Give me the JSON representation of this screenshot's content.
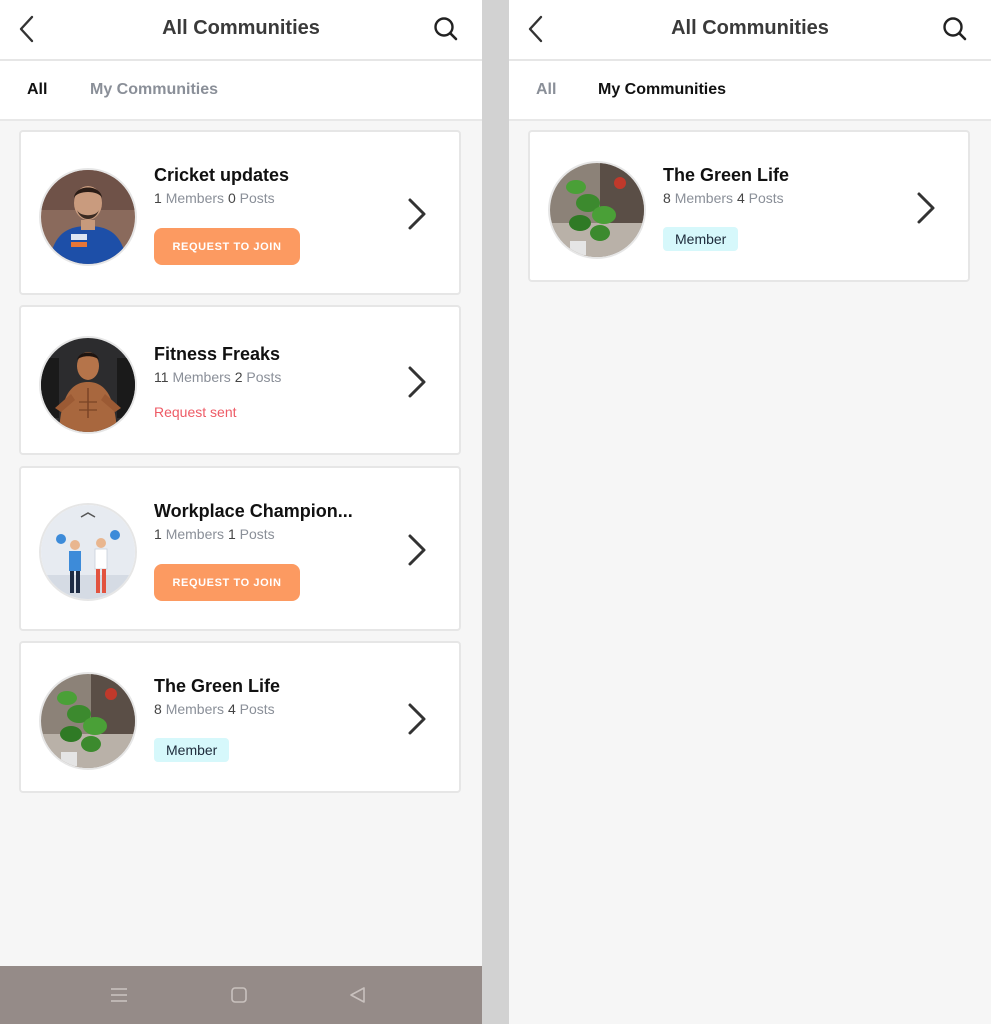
{
  "left": {
    "header": {
      "title": "All Communities",
      "back_icon": "chevron-left-icon",
      "search_icon": "search-icon"
    },
    "tabs": [
      {
        "label": "All",
        "active": true
      },
      {
        "label": "My Communities",
        "active": false
      }
    ],
    "communities": [
      {
        "name": "Cricket updates",
        "members": "1",
        "members_label": "Members",
        "posts": "0",
        "posts_label": "Posts",
        "action": "REQUEST TO JOIN",
        "avatar": "cricketer-photo"
      },
      {
        "name": "Fitness Freaks",
        "members": "11",
        "members_label": "Members",
        "posts": "2",
        "posts_label": "Posts",
        "status": "Request sent",
        "avatar": "bodybuilder-photo"
      },
      {
        "name": "Workplace Champion...",
        "members": "1",
        "members_label": "Members",
        "posts": "1",
        "posts_label": "Posts",
        "action": "REQUEST TO JOIN",
        "avatar": "workplace-illustration"
      },
      {
        "name": "The Green Life",
        "members": "8",
        "members_label": "Members",
        "posts": "4",
        "posts_label": "Posts",
        "badge": "Member",
        "avatar": "plant-photo"
      }
    ],
    "system_nav": {
      "menu_icon": "menu-icon",
      "home_icon": "home-square-icon",
      "back_icon": "back-triangle-icon"
    }
  },
  "right": {
    "header": {
      "title": "All Communities",
      "back_icon": "chevron-left-icon",
      "search_icon": "search-icon"
    },
    "tabs": [
      {
        "label": "All",
        "active": false
      },
      {
        "label": "My Communities",
        "active": true
      }
    ],
    "communities": [
      {
        "name": "The Green Life",
        "members": "8",
        "members_label": "Members",
        "posts": "4",
        "posts_label": "Posts",
        "badge": "Member",
        "avatar": "plant-photo"
      }
    ]
  },
  "colors": {
    "accent_orange": "#fc9a61",
    "request_sent_red": "#ee5b66",
    "member_badge_bg": "#d6f8fb",
    "nav_bar": "#958b88"
  }
}
